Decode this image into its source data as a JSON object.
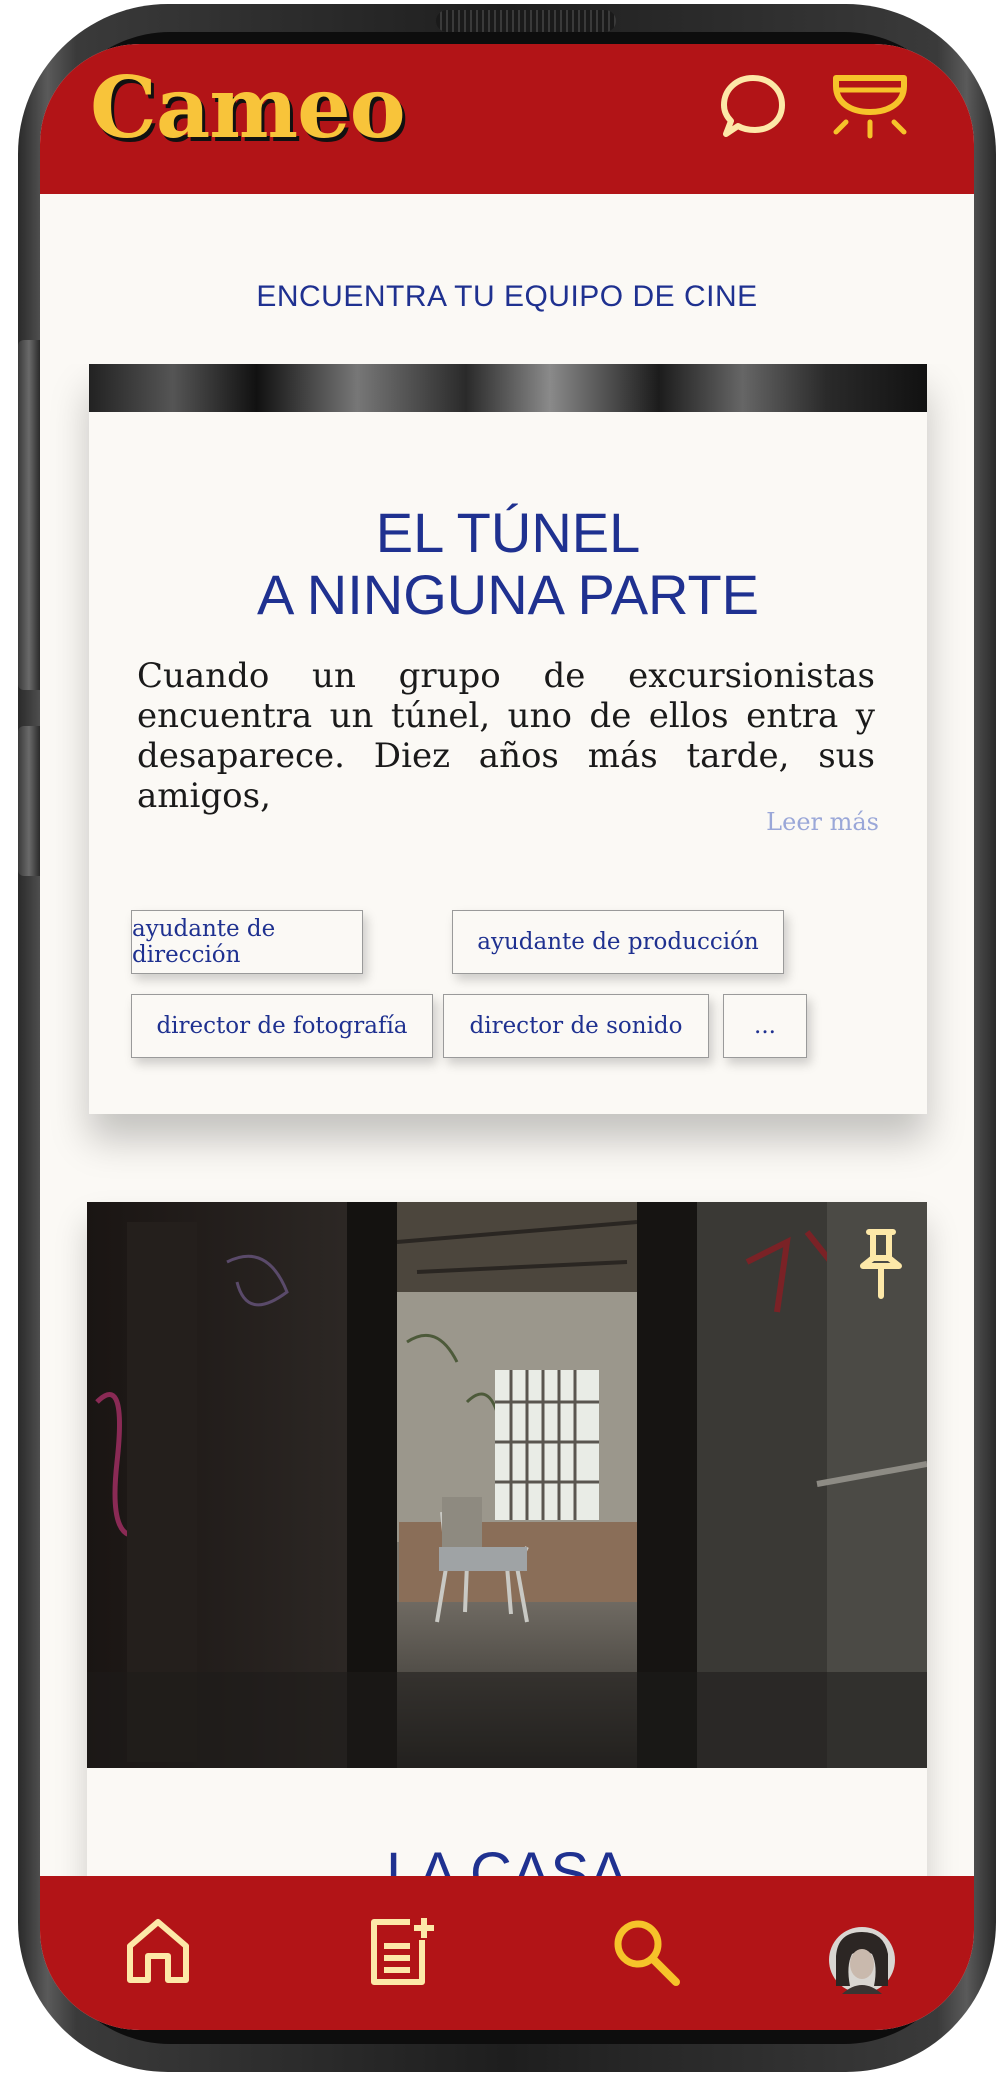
{
  "app": {
    "name": "Cameo"
  },
  "header": {
    "chat_icon": "chat-bubble-icon",
    "alert_icon": "alarm-light-icon"
  },
  "tagline": "ENCUENTRA TU EQUIPO DE CINE",
  "cards": [
    {
      "title_line1": "EL TÚNEL",
      "title_line2": "A NINGUNA PARTE",
      "description": "Cuando un grupo de excursionistas encuentra un túnel, uno de ellos entra y desaparece. Diez años más tarde, sus amigos,",
      "read_more": "Leer más",
      "roles": [
        "ayudante de dirección",
        "ayudante de producción",
        "director de fotografía",
        "director de sonido",
        "..."
      ]
    },
    {
      "title": "LA CASA",
      "pin_icon": "pin-icon"
    }
  ],
  "bottom_nav": [
    {
      "icon": "home-icon"
    },
    {
      "icon": "add-note-icon"
    },
    {
      "icon": "search-icon"
    },
    {
      "icon": "profile-avatar"
    }
  ],
  "colors": {
    "brand_red": "#b21417",
    "logo_yellow": "#f8c43a",
    "icon_cream": "#fde8a8",
    "text_blue": "#1f3190",
    "background": "#fbf9f5"
  }
}
